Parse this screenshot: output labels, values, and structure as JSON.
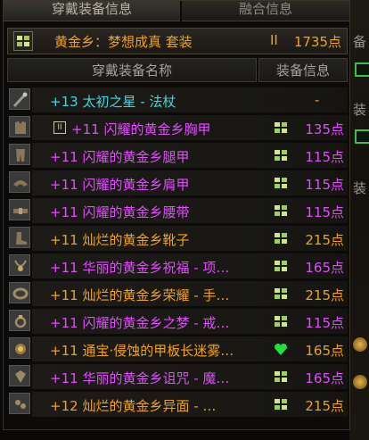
{
  "tabs": [
    {
      "label": "穿戴装备信息",
      "active": true
    },
    {
      "label": "融合信息",
      "active": false
    }
  ],
  "set": {
    "name": "黄金乡：梦想成真   套装",
    "tier": "II",
    "points": "1735点",
    "icon": "set-emblem-icon"
  },
  "columns": {
    "name": "穿戴装备名称",
    "info": "装备信息"
  },
  "colors": {
    "cyan": "#3ed8e0",
    "magenta": "#e24bff",
    "orange": "#f0a21a",
    "set_green": "#9bd35a",
    "bright_green": "#22e03a"
  },
  "items": [
    {
      "slot_icon": "staff-icon",
      "plus": "+13",
      "name": "太初之星 - 法杖",
      "color": "cyan",
      "locked": false,
      "mark": "none",
      "points": "-"
    },
    {
      "slot_icon": "chest-armor-icon",
      "plus": "+11",
      "name": "闪耀的黄金乡胸甲",
      "color": "magenta",
      "locked": true,
      "lock_label": "II",
      "mark": "set",
      "points": "135点"
    },
    {
      "slot_icon": "leg-armor-icon",
      "plus": "+11",
      "name": "闪耀的黄金乡腿甲",
      "color": "magenta",
      "locked": false,
      "mark": "set",
      "points": "115点"
    },
    {
      "slot_icon": "shoulder-armor-icon",
      "plus": "+11",
      "name": "闪耀的黄金乡肩甲",
      "color": "magenta",
      "locked": false,
      "mark": "set",
      "points": "115点"
    },
    {
      "slot_icon": "belt-icon",
      "plus": "+11",
      "name": "闪耀的黄金乡腰带",
      "color": "magenta",
      "locked": false,
      "mark": "set",
      "points": "115点"
    },
    {
      "slot_icon": "boots-icon",
      "plus": "+11",
      "name": "灿烂的黄金乡靴子",
      "color": "orange",
      "locked": false,
      "mark": "set",
      "points": "215点"
    },
    {
      "slot_icon": "necklace-icon",
      "plus": "+11",
      "name": "华丽的黄金乡祝福 - 项…",
      "color": "magenta",
      "locked": false,
      "mark": "set",
      "points": "165点"
    },
    {
      "slot_icon": "bracelet-icon",
      "plus": "+11",
      "name": "灿烂的黄金乡荣耀 - 手…",
      "color": "orange",
      "locked": false,
      "mark": "set",
      "points": "215点"
    },
    {
      "slot_icon": "ring-icon",
      "plus": "+11",
      "name": "闪耀的黄金乡之梦 - 戒…",
      "color": "magenta",
      "locked": false,
      "mark": "set",
      "points": "115点"
    },
    {
      "slot_icon": "jewel-icon",
      "plus": "+11",
      "name": "通宝·侵蚀的甲板长迷雾…",
      "color": "orange",
      "locked": false,
      "mark": "heart",
      "points": "165点"
    },
    {
      "slot_icon": "gem-icon",
      "plus": "+11",
      "name": "华丽的黄金乡诅咒 - 魔…",
      "color": "magenta",
      "locked": false,
      "mark": "set",
      "points": "165点"
    },
    {
      "slot_icon": "earring-icon",
      "plus": "+12",
      "name": "灿烂的黄金乡异面 - …",
      "color": "orange",
      "locked": false,
      "mark": "set",
      "points": "215点"
    }
  ],
  "side": {
    "frag1": "备",
    "frag2": "装",
    "frag3": "装"
  }
}
